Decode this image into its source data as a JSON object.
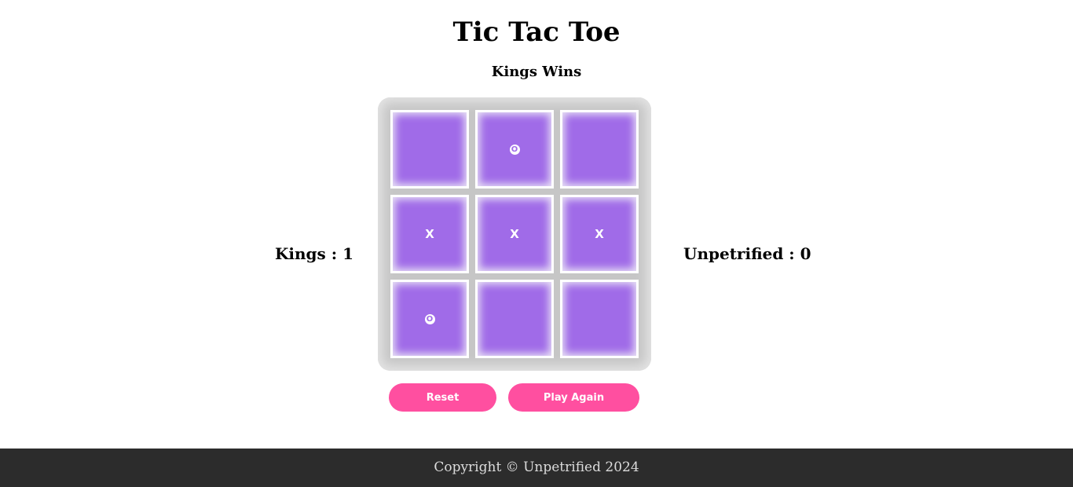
{
  "header": {
    "title": "Tic Tac Toe",
    "status": "Kings Wins"
  },
  "scores": {
    "left": "Kings : 1",
    "right": "Unpetrified : 0"
  },
  "board": {
    "cells": [
      "",
      "O",
      "",
      "X",
      "X",
      "X",
      "O",
      "",
      ""
    ]
  },
  "buttons": {
    "reset": "Reset",
    "play_again": "Play Again"
  },
  "footer": {
    "text": "Copyright © Unpetrified 2024"
  },
  "colors": {
    "cell": "#a06be8",
    "board": "#c6c6c6",
    "button": "#ff4fa0",
    "footer_bg": "#2c2c2c"
  },
  "icons": {
    "X": "x-mark-icon",
    "O": "o-mark-icon"
  }
}
